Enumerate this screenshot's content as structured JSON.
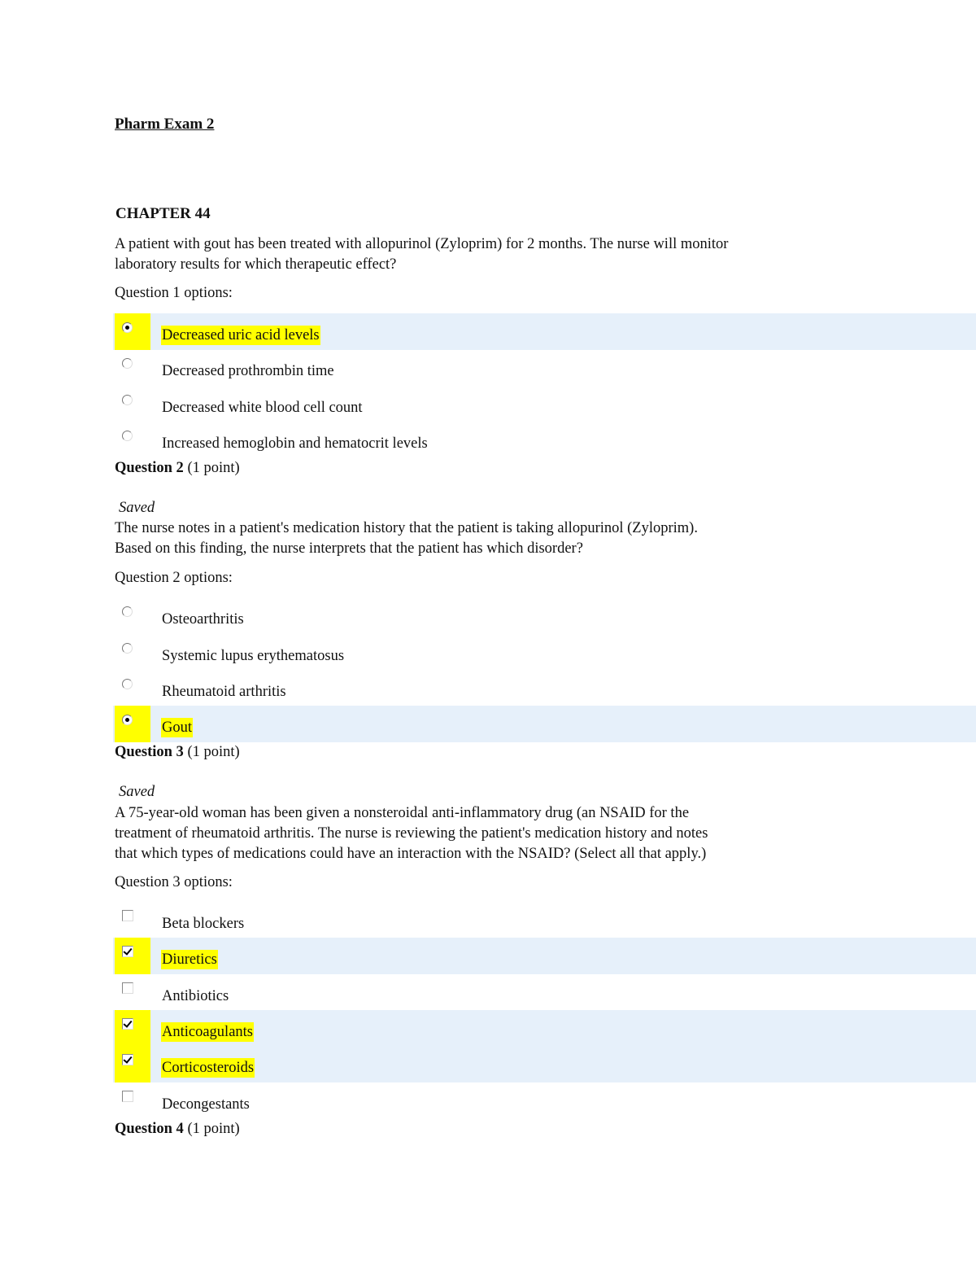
{
  "document": {
    "title": "Pharm Exam 2",
    "chapter": "CHAPTER 44"
  },
  "questions": [
    {
      "text": "A patient with gout has been treated with allopurinol (Zyloprim) for 2 months. The nurse will monitor laboratory results for which therapeutic effect?",
      "text_lines": [
        "A patient with gout has been treated with allopurinol (Zyloprim) for 2 months. The nurse will monitor",
        "laboratory results for which therapeutic effect?"
      ],
      "options_label": "Question 1 options:",
      "type": "radio",
      "options": [
        {
          "label": "Decreased uric acid levels",
          "selected": true
        },
        {
          "label": "Decreased prothrombin time",
          "selected": false
        },
        {
          "label": "Decreased white blood cell count",
          "selected": false
        },
        {
          "label": "Increased hemoglobin and hematocrit levels",
          "selected": false
        }
      ]
    },
    {
      "heading": "Question 2",
      "points": "(1 point)",
      "status": "Saved",
      "text_lines": [
        "The nurse notes in a patient's medication history that the patient is taking allopurinol (Zyloprim).",
        "Based on this finding, the nurse interprets that the patient has which disorder?"
      ],
      "options_label": "Question 2 options:",
      "type": "radio",
      "options": [
        {
          "label": "Osteoarthritis",
          "selected": false
        },
        {
          "label": "Systemic lupus erythematosus",
          "selected": false
        },
        {
          "label": "Rheumatoid arthritis",
          "selected": false
        },
        {
          "label": "Gout",
          "selected": true
        }
      ]
    },
    {
      "heading": "Question 3",
      "points": "(1 point)",
      "status": "Saved",
      "text_lines": [
        "A 75-year-old woman has been given a nonsteroidal anti-inflammatory drug (an NSAID for the",
        "treatment of rheumatoid arthritis. The nurse is reviewing the patient's medication history and notes",
        "that which types of medications could have an interaction with the NSAID? (Select all that apply.)"
      ],
      "options_label": "Question 3 options:",
      "type": "checkbox",
      "options": [
        {
          "label": "Beta blockers",
          "selected": false
        },
        {
          "label": "Diuretics",
          "selected": true
        },
        {
          "label": "Antibiotics",
          "selected": false
        },
        {
          "label": "Anticoagulants",
          "selected": true
        },
        {
          "label": "Corticosteroids",
          "selected": true
        },
        {
          "label": "Decongestants",
          "selected": false
        }
      ]
    },
    {
      "heading": "Question 4",
      "points": "(1 point)"
    }
  ],
  "colors": {
    "highlight": "#ffff00",
    "selected_row": "#e6f0fa"
  }
}
